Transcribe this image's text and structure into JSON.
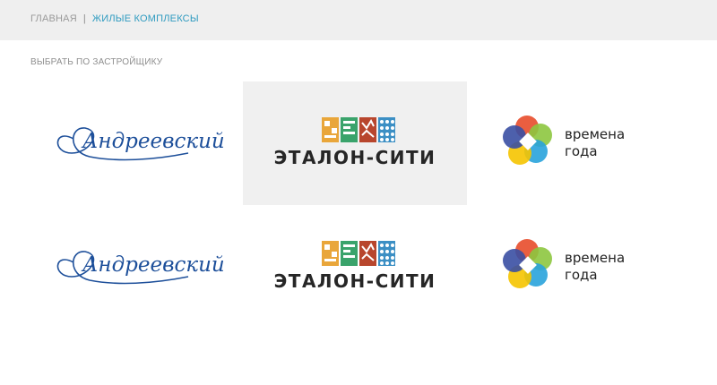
{
  "breadcrumb": {
    "home": "ГЛАВНАЯ",
    "separator": "|",
    "current": "ЖИЛЫЕ КОМПЛЕКСЫ"
  },
  "filter_label": "ВЫБРАТЬ ПО ЗАСТРОЙЩИКУ",
  "developers": [
    {
      "logo_text": "Андреевский",
      "selected": false
    },
    {
      "logo_text": "ЭТАЛОН-СИТИ",
      "selected": true
    },
    {
      "logo_text_line1": "времена",
      "logo_text_line2": "года",
      "selected": false
    }
  ],
  "developers_row2": [
    {
      "logo_text": "Андреевский"
    },
    {
      "logo_text": "ЭТАЛОН-СИТИ"
    },
    {
      "logo_text_line1": "времена",
      "logo_text_line2": "года"
    }
  ],
  "colors": {
    "accent": "#2f9bc0",
    "andreevsky_blue": "#1d4f9a",
    "selected_bg": "#f0f0f0"
  }
}
